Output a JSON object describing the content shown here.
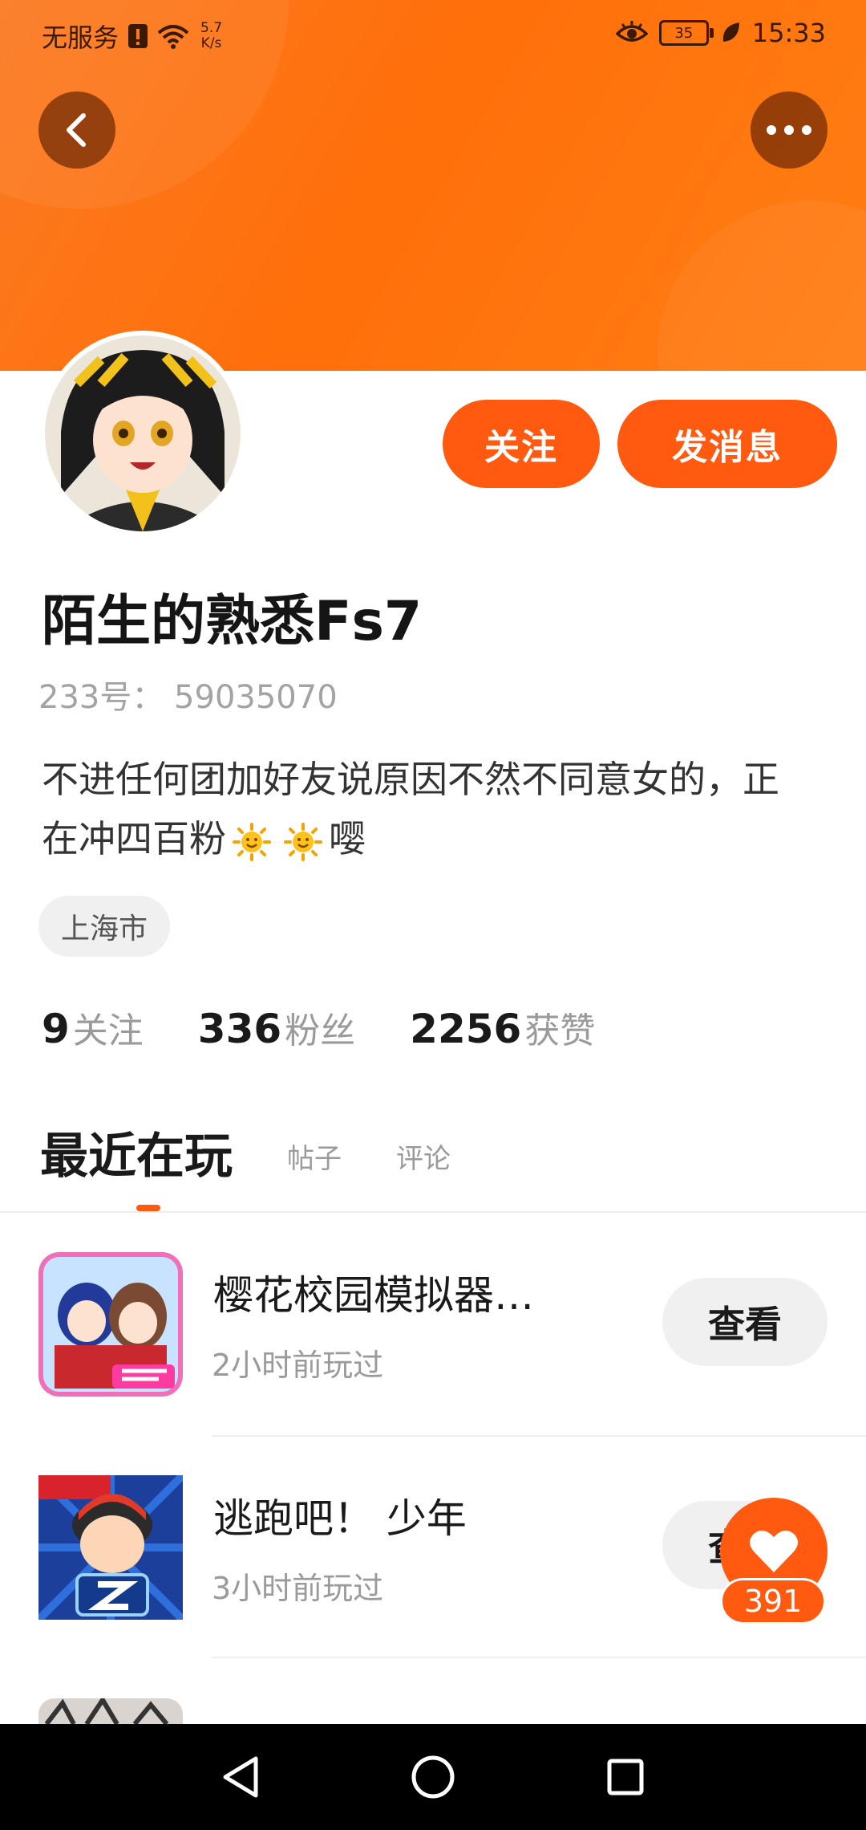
{
  "status_bar": {
    "carrier": "无服务",
    "speed_value": "5.7",
    "speed_unit": "K/s",
    "battery": "35",
    "time": "15:33"
  },
  "profile": {
    "follow_label": "关注",
    "message_label": "发消息",
    "username": "陌生的熟悉Fs7",
    "uid": "233号： 59035070",
    "bio_part1": "不进任何团加好友说原因不然不同意女的，正在冲四百粉",
    "bio_part2": "嘤",
    "location": "上海市",
    "stats": [
      {
        "num": "9",
        "label": "关注"
      },
      {
        "num": "336",
        "label": "粉丝"
      },
      {
        "num": "2256",
        "label": "获赞"
      }
    ]
  },
  "tabs": [
    {
      "label": "最近在玩",
      "active": true
    },
    {
      "label": "帖子",
      "active": false
    },
    {
      "label": "评论",
      "active": false
    }
  ],
  "games": [
    {
      "name": "樱花校园模拟器…",
      "time": "2小时前玩过",
      "button": "查看"
    },
    {
      "name": "逃跑吧！ 少年",
      "time": "3小时前玩过",
      "button": "查看"
    }
  ],
  "like": {
    "count": "391"
  },
  "colors": {
    "accent": "#ff5a0f",
    "header": "#ff6f0a"
  },
  "icons": [
    "back-arrow-icon",
    "more-dots-icon",
    "heart-icon",
    "sun-emoji-icon",
    "nav-back-icon",
    "nav-home-icon",
    "nav-recents-icon"
  ]
}
